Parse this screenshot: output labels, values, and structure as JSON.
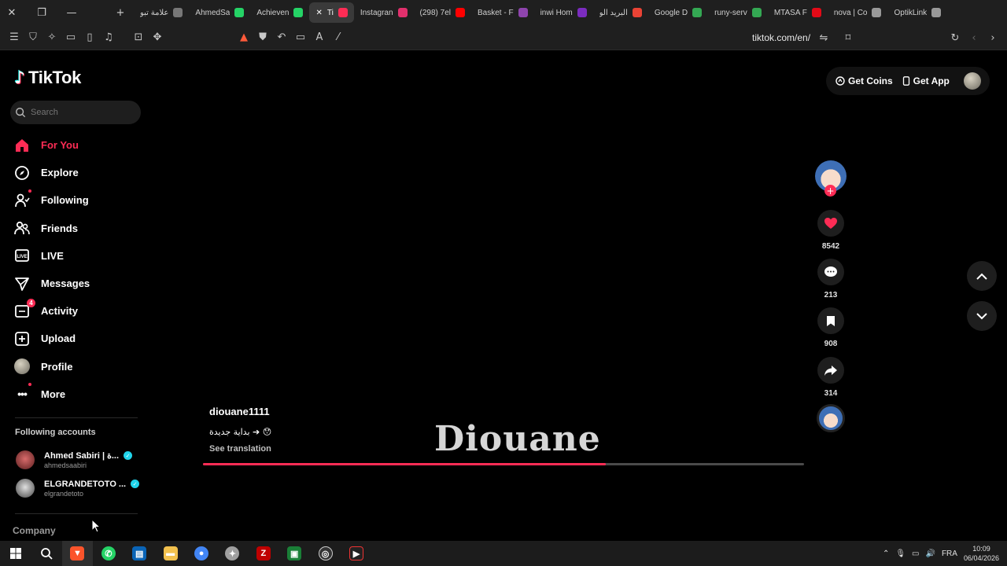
{
  "browser": {
    "tabs": [
      {
        "title": "علامة تبو",
        "icon_color": "#777777",
        "active": false
      },
      {
        "title": "AhmedSa",
        "icon_color": "#25d366",
        "active": false
      },
      {
        "title": "Achieven",
        "icon_color": "#25d366",
        "active": false
      },
      {
        "title": "Ti",
        "icon_color": "#fe2c55",
        "active": true
      },
      {
        "title": "Instagran",
        "icon_color": "#e1306c",
        "active": false
      },
      {
        "title": "(298) 7el",
        "icon_color": "#ff0000",
        "active": false
      },
      {
        "title": "Basket - F",
        "icon_color": "#8e44ad",
        "active": false
      },
      {
        "title": "inwi Hom",
        "icon_color": "#7b2cbf",
        "active": false
      },
      {
        "title": "البريد الو",
        "icon_color": "#ea4335",
        "active": false
      },
      {
        "title": "Google D",
        "icon_color": "#34a853",
        "active": false
      },
      {
        "title": "runy-serv",
        "icon_color": "#34a853",
        "active": false
      },
      {
        "title": "MTASA F",
        "icon_color": "#e30a17",
        "active": false
      },
      {
        "title": "nova | Co",
        "icon_color": "#999999",
        "active": false
      },
      {
        "title": "OptikLink",
        "icon_color": "#999999",
        "active": false
      }
    ],
    "url": "tiktok.com/en/"
  },
  "tiktok": {
    "logo_text": "TikTok",
    "search_placeholder": "Search",
    "nav": [
      {
        "label": "For You",
        "icon": "home-icon",
        "active": true
      },
      {
        "label": "Explore",
        "icon": "compass-icon"
      },
      {
        "label": "Following",
        "icon": "following-icon",
        "dot": true
      },
      {
        "label": "Friends",
        "icon": "friends-icon"
      },
      {
        "label": "LIVE",
        "icon": "live-icon"
      },
      {
        "label": "Messages",
        "icon": "messages-icon"
      },
      {
        "label": "Activity",
        "icon": "activity-icon",
        "badge": "4"
      },
      {
        "label": "Upload",
        "icon": "upload-icon"
      },
      {
        "label": "Profile",
        "icon": "profile-avatar"
      },
      {
        "label": "More",
        "icon": "more-icon",
        "dot": true
      }
    ],
    "following_title": "Following accounts",
    "following_accounts": [
      {
        "name": "Ahmed Sabiri | ة...",
        "handle": "ahmedsaabiri"
      },
      {
        "name": "ELGRANDETOTO ...",
        "handle": "elgrandetoto"
      }
    ],
    "company_label": "Company",
    "header": {
      "get_coins": "Get Coins",
      "get_app": "Get App"
    },
    "video": {
      "author": "diouane1111",
      "caption": "بداية جديدة ➔ 😯",
      "see_translation": "See translation",
      "watermark": "Diouane",
      "progress": 0.67
    },
    "actions": {
      "likes": "8542",
      "comments": "213",
      "saves": "908",
      "shares": "314"
    }
  },
  "taskbar": {
    "language": "FRA",
    "time": "10:09",
    "date": "06/04/2026"
  }
}
